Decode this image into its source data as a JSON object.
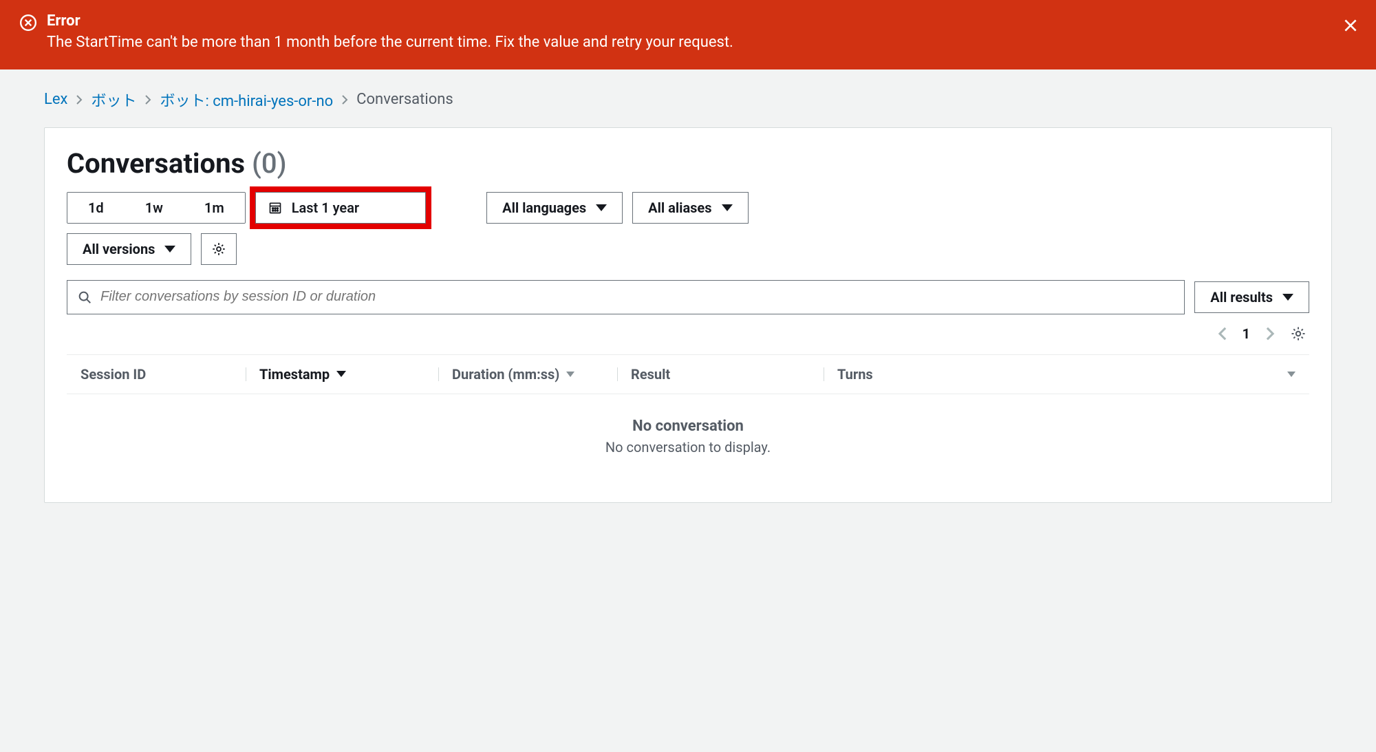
{
  "error": {
    "title": "Error",
    "message": "The StartTime can't be more than 1 month before the current time. Fix the value and retry your request."
  },
  "breadcrumb": {
    "items": [
      "Lex",
      "ボット",
      "ボット: cm-hirai-yes-or-no"
    ],
    "current": "Conversations"
  },
  "page": {
    "title": "Conversations",
    "count": "(0)"
  },
  "timeRange": {
    "segments": [
      "1d",
      "1w",
      "1m"
    ],
    "custom": "Last 1 year"
  },
  "filters": {
    "languages": "All languages",
    "aliases": "All aliases",
    "versions": "All versions",
    "results": "All results"
  },
  "search": {
    "placeholder": "Filter conversations by session ID or duration"
  },
  "pagination": {
    "page": "1"
  },
  "table": {
    "columns": {
      "session": "Session ID",
      "timestamp": "Timestamp",
      "duration": "Duration (mm:ss)",
      "result": "Result",
      "turns": "Turns"
    },
    "empty": {
      "title": "No conversation",
      "subtitle": "No conversation to display."
    }
  }
}
